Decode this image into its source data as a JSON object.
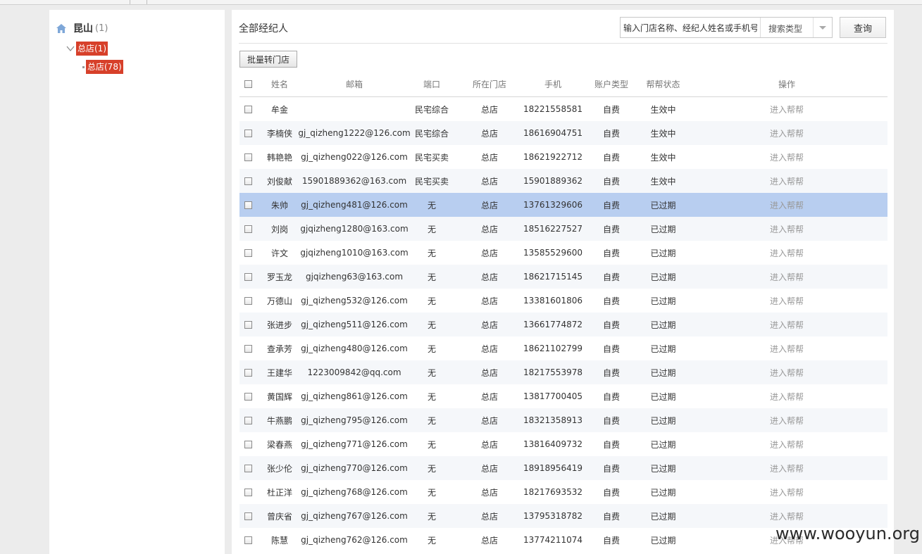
{
  "sidebar": {
    "root_name": "昆山",
    "root_count": "(1)",
    "node_label": "总店(1)",
    "leaf_label": "总店(78)"
  },
  "main": {
    "title": "全部经纪人",
    "search_placeholder": "输入门店名称、经纪人姓名或手机号",
    "search_type_label": "搜索类型",
    "query_label": "查询",
    "batch_label": "批量转门店"
  },
  "table": {
    "headers": [
      "姓名",
      "邮箱",
      "端口",
      "所在门店",
      "手机",
      "账户类型",
      "帮帮状态",
      "操作"
    ],
    "rows": [
      {
        "name": "牟金",
        "email": "",
        "port": "民宅综合",
        "store": "总店",
        "phone": "18221558581",
        "account": "自费",
        "status": "生效中",
        "action": "进入帮帮"
      },
      {
        "name": "李楠侠",
        "email": "gj_qizheng1222@126.com",
        "port": "民宅综合",
        "store": "总店",
        "phone": "18616904751",
        "account": "自费",
        "status": "生效中",
        "action": "进入帮帮"
      },
      {
        "name": "韩艳艳",
        "email": "gj_qizheng022@126.com",
        "port": "民宅买卖",
        "store": "总店",
        "phone": "18621922712",
        "account": "自费",
        "status": "生效中",
        "action": "进入帮帮"
      },
      {
        "name": "刘俊献",
        "email": "15901889362@163.com",
        "port": "民宅买卖",
        "store": "总店",
        "phone": "15901889362",
        "account": "自费",
        "status": "生效中",
        "action": "进入帮帮"
      },
      {
        "name": "朱帅",
        "email": "gj_qizheng481@126.com",
        "port": "无",
        "store": "总店",
        "phone": "13761329606",
        "account": "自费",
        "status": "已过期",
        "action": "进入帮帮"
      },
      {
        "name": "刘岗",
        "email": "gjqizheng1280@163.com",
        "port": "无",
        "store": "总店",
        "phone": "18516227527",
        "account": "自费",
        "status": "已过期",
        "action": "进入帮帮"
      },
      {
        "name": "许文",
        "email": "gjqizheng1010@163.com",
        "port": "无",
        "store": "总店",
        "phone": "13585529600",
        "account": "自费",
        "status": "已过期",
        "action": "进入帮帮"
      },
      {
        "name": "罗玉龙",
        "email": "gjqizheng63@163.com",
        "port": "无",
        "store": "总店",
        "phone": "18621715145",
        "account": "自费",
        "status": "已过期",
        "action": "进入帮帮"
      },
      {
        "name": "万德山",
        "email": "gj_qizheng532@126.com",
        "port": "无",
        "store": "总店",
        "phone": "13381601806",
        "account": "自费",
        "status": "已过期",
        "action": "进入帮帮"
      },
      {
        "name": "张进步",
        "email": "gj_qizheng511@126.com",
        "port": "无",
        "store": "总店",
        "phone": "13661774872",
        "account": "自费",
        "status": "已过期",
        "action": "进入帮帮"
      },
      {
        "name": "查承芳",
        "email": "gj_qizheng480@126.com",
        "port": "无",
        "store": "总店",
        "phone": "18621102799",
        "account": "自费",
        "status": "已过期",
        "action": "进入帮帮"
      },
      {
        "name": "王建华",
        "email": "1223009842@qq.com",
        "port": "无",
        "store": "总店",
        "phone": "18217553978",
        "account": "自费",
        "status": "已过期",
        "action": "进入帮帮"
      },
      {
        "name": "黄国辉",
        "email": "gj_qizheng861@126.com",
        "port": "无",
        "store": "总店",
        "phone": "13817700405",
        "account": "自费",
        "status": "已过期",
        "action": "进入帮帮"
      },
      {
        "name": "牛燕鹏",
        "email": "gj_qizheng795@126.com",
        "port": "无",
        "store": "总店",
        "phone": "18321358913",
        "account": "自费",
        "status": "已过期",
        "action": "进入帮帮"
      },
      {
        "name": "梁春燕",
        "email": "gj_qizheng771@126.com",
        "port": "无",
        "store": "总店",
        "phone": "13816409732",
        "account": "自费",
        "status": "已过期",
        "action": "进入帮帮"
      },
      {
        "name": "张少伦",
        "email": "gj_qizheng770@126.com",
        "port": "无",
        "store": "总店",
        "phone": "18918956419",
        "account": "自费",
        "status": "已过期",
        "action": "进入帮帮"
      },
      {
        "name": "杜正洋",
        "email": "gj_qizheng768@126.com",
        "port": "无",
        "store": "总店",
        "phone": "18217693532",
        "account": "自费",
        "status": "已过期",
        "action": "进入帮帮"
      },
      {
        "name": "曾庆省",
        "email": "gj_qizheng767@126.com",
        "port": "无",
        "store": "总店",
        "phone": "13795318782",
        "account": "自费",
        "status": "已过期",
        "action": "进入帮帮"
      },
      {
        "name": "陈慧",
        "email": "gj_qizheng762@126.com",
        "port": "无",
        "store": "总店",
        "phone": "13774211074",
        "account": "自费",
        "status": "已过期",
        "action": "进入帮帮"
      }
    ]
  },
  "watermark": "www.wooyun.org",
  "colors": {
    "tag_red": "#d7402a",
    "selected_row": "#b8cef0",
    "alt_row": "#f5f7fa"
  }
}
